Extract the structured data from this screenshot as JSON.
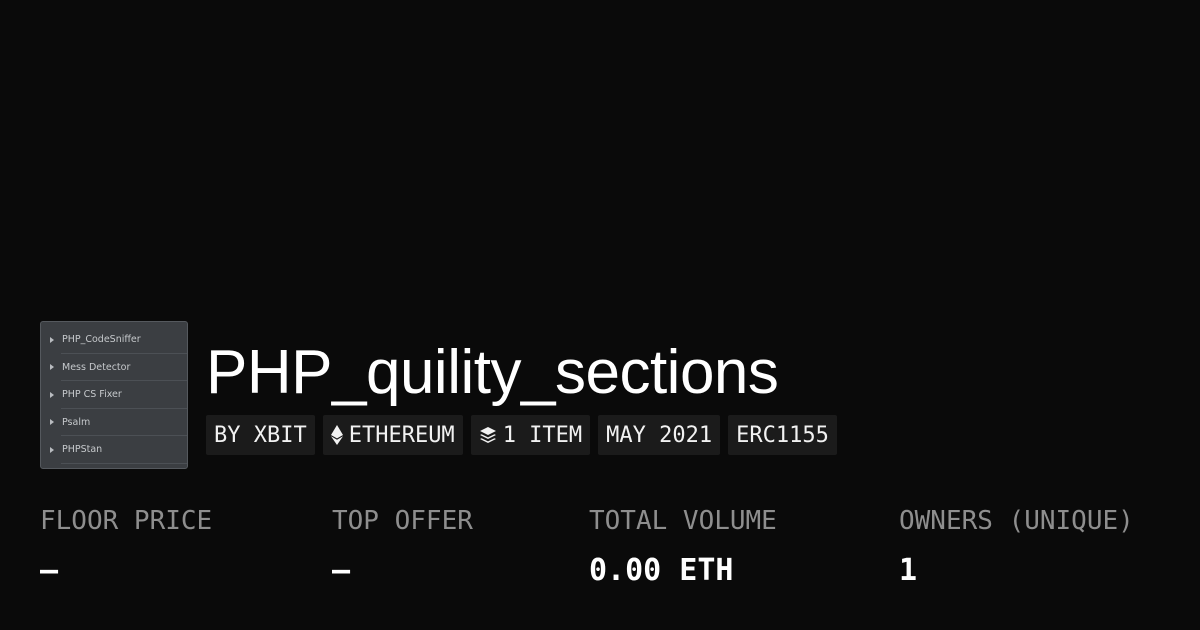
{
  "collection": {
    "title": "PHP_quility_sections",
    "thumbnail": {
      "items": [
        "PHP_CodeSniffer",
        "Mess Detector",
        "PHP CS Fixer",
        "Psalm",
        "PHPStan"
      ]
    },
    "tags": [
      {
        "label": "BY XBIT",
        "icon": null
      },
      {
        "label": "ETHEREUM",
        "icon": "ethereum-icon"
      },
      {
        "label": "1 ITEM",
        "icon": "layers-icon"
      },
      {
        "label": "MAY 2021",
        "icon": null
      },
      {
        "label": "ERC1155",
        "icon": null
      }
    ]
  },
  "stats": [
    {
      "label": "FLOOR PRICE",
      "value": "—"
    },
    {
      "label": "TOP OFFER",
      "value": "—"
    },
    {
      "label": "TOTAL VOLUME",
      "value": "0.00 ETH"
    },
    {
      "label": "OWNERS (UNIQUE)",
      "value": "1"
    }
  ],
  "colors": {
    "background": "#0a0a0a",
    "tag_background": "#1b1b1b",
    "stat_label": "#8e8e8e",
    "text": "#ffffff"
  }
}
